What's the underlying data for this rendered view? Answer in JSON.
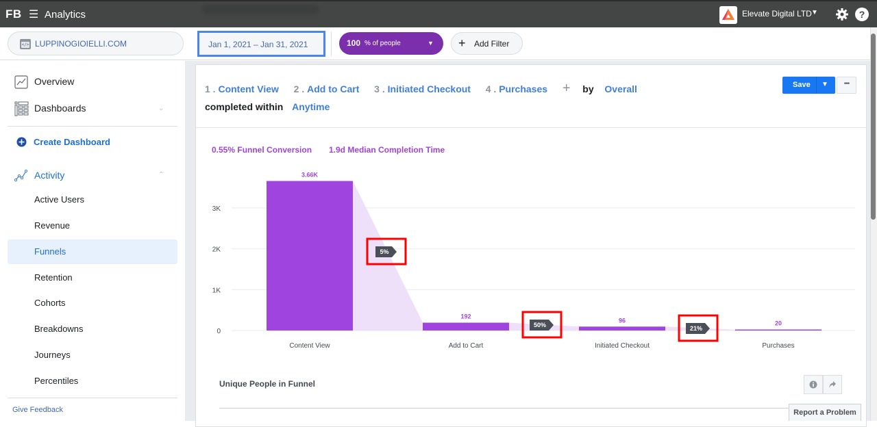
{
  "topbar": {
    "logo": "FB",
    "menu_icon": "hamburger-icon",
    "app_title": "Analytics",
    "account_name": "Elevate Digital LTD",
    "icons": [
      "account-logo-icon",
      "caret-down-icon",
      "gear-icon",
      "help-icon"
    ],
    "help_glyph": "?"
  },
  "filters": {
    "site": "LUPPINOGIOIELLI.COM",
    "site_icon": "website-code-icon",
    "date_range": "Jan 1, 2021 – Jan 31, 2021",
    "people_value": "100",
    "people_label": "% of people",
    "add_filter": "Add Filter",
    "add_glyph": "+"
  },
  "sidebar": {
    "overview": "Overview",
    "dashboards": "Dashboards",
    "create_dashboard": "Create Dashboard",
    "activity": "Activity",
    "activity_items": [
      "Active Users",
      "Revenue",
      "Funnels",
      "Retention",
      "Cohorts",
      "Breakdowns",
      "Journeys",
      "Percentiles"
    ],
    "active_item": "Funnels",
    "give_feedback": "Give Feedback"
  },
  "query": {
    "steps": [
      {
        "num": "1 .",
        "name": "Content View"
      },
      {
        "num": "2 .",
        "name": "Add to Cart"
      },
      {
        "num": "3 .",
        "name": "Initiated Checkout"
      },
      {
        "num": "4 .",
        "name": "Purchases"
      }
    ],
    "add_step_glyph": "+",
    "by_label": "by",
    "by_value": "Overall",
    "completed_label": "completed within",
    "completed_value": "Anytime",
    "save": "Save",
    "more_glyph": "•••"
  },
  "metrics": {
    "conversion": "0.55% Funnel Conversion",
    "median_time": "1.9d Median Completion Time"
  },
  "colors": {
    "bar": "#a044e0",
    "connector": "#efe0f9",
    "tag": "#4b4f58",
    "highlight": "#ff0000",
    "link": "#4080d6",
    "accent_purple": "#7b2fad",
    "save_blue": "#1877f2"
  },
  "chart_data": {
    "type": "bar",
    "title": "",
    "xlabel": "",
    "ylabel": "",
    "categories": [
      "Content View",
      "Add to Cart",
      "Initiated Checkout",
      "Purchases"
    ],
    "values": [
      3660,
      192,
      96,
      20
    ],
    "value_labels": [
      "3.66K",
      "192",
      "96",
      "20"
    ],
    "step_conversion_labels": [
      "5%",
      "50%",
      "21%"
    ],
    "y_ticks": [
      0,
      1000,
      2000,
      3000
    ],
    "y_tick_labels": [
      "0",
      "1K",
      "2K",
      "3K"
    ],
    "ylim": [
      0,
      3700
    ],
    "grid": true,
    "legend": "none"
  },
  "table": {
    "title": "Unique People in Funnel",
    "info_icon": "info-icon",
    "share_icon": "share-icon"
  },
  "report_problem": "Report a Problem"
}
